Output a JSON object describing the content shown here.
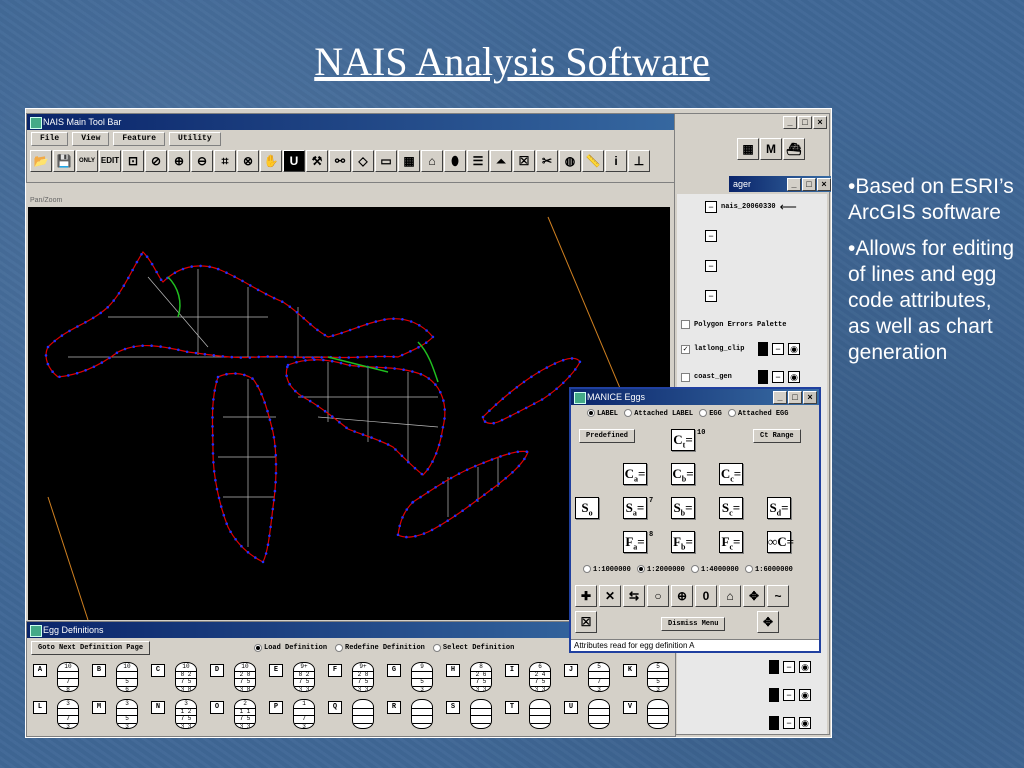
{
  "slide": {
    "title": "NAIS Analysis Software",
    "bullets": [
      "•Based on ESRI’s ArcGIS software",
      "•Allows for editing of lines and egg code attributes, as well as chart generation"
    ]
  },
  "main_toolbar": {
    "title": "NAIS Main Tool Bar",
    "menus": [
      "File",
      "View",
      "Feature",
      "Utility"
    ],
    "tools": [
      "open-folder",
      "save",
      "only",
      "edit",
      "select",
      "erase",
      "zoom-in",
      "zoom-out",
      "crop",
      "target",
      "pan-hand",
      "magnet",
      "hammer",
      "binoculars",
      "diamond",
      "rectangle",
      "grid",
      "polygon",
      "egg",
      "lines",
      "profile",
      "box-x",
      "scissors",
      "palette",
      "ruler",
      "info",
      "pin"
    ],
    "edit_label": "EDIT",
    "only_label": "ONLY"
  },
  "map_view": {
    "label": "Pan/Zoom"
  },
  "layer_manager": {
    "title": "ager",
    "extra_tools": [
      "checkered",
      "M",
      "ship"
    ],
    "layers": [
      {
        "name": "nais_20060330",
        "checked": false
      },
      {
        "name": "",
        "checked": false
      },
      {
        "name": "",
        "checked": false
      },
      {
        "name": "",
        "checked": false
      },
      {
        "name": "Polygon Errors Palette",
        "checked": false
      },
      {
        "name": "latlong_clip",
        "checked": true
      },
      {
        "name": "coast_gen",
        "checked": false
      }
    ]
  },
  "manice_eggs": {
    "title": "MANICE Eggs",
    "radio_options": [
      "LABEL",
      "Attached LABEL",
      "EGG",
      "Attached EGG"
    ],
    "selected_radio": "LABEL",
    "predefined_label": "Predefined",
    "ct_range_label": "Ct Range",
    "ct_value": "10",
    "sa_value": "7",
    "fa_value": "8",
    "scales": [
      "1:1000000",
      "1:2000000",
      "1:4000000",
      "1:6000000"
    ],
    "selected_scale": "1:2000000",
    "dismiss_label": "Dismiss Menu",
    "status": "Attributes read for egg definition A"
  },
  "egg_definitions": {
    "title": "Egg Definitions",
    "goto_label": "Goto Next Definition Page",
    "modes": [
      "Load Definition",
      "Redefine Definition",
      "Select Definition"
    ],
    "selected_mode": "Load Definition",
    "row1": [
      {
        "label": "A",
        "vals": [
          "10",
          "",
          "7",
          "8"
        ]
      },
      {
        "label": "B",
        "vals": [
          "10",
          "",
          "5",
          "6"
        ]
      },
      {
        "label": "C",
        "vals": [
          "10",
          "8 2",
          "7 5",
          "3 8"
        ]
      },
      {
        "label": "D",
        "vals": [
          "10",
          "2 8",
          "7 5",
          "3 8"
        ]
      },
      {
        "label": "E",
        "vals": [
          "9+",
          "8 2",
          "7 5",
          "3 3"
        ]
      },
      {
        "label": "F",
        "vals": [
          "9+",
          "2 8",
          "7 5",
          "3 3"
        ]
      },
      {
        "label": "G",
        "vals": [
          "9",
          "",
          "5",
          "3"
        ]
      },
      {
        "label": "H",
        "vals": [
          "8",
          "2 6",
          "7 5",
          "3 3"
        ]
      },
      {
        "label": "I",
        "vals": [
          "6",
          "2 4",
          "7 5",
          "3 3"
        ]
      },
      {
        "label": "J",
        "vals": [
          "5",
          "",
          "7",
          "3"
        ]
      },
      {
        "label": "K",
        "vals": [
          "5",
          "",
          "5",
          "3"
        ]
      }
    ],
    "row2": [
      {
        "label": "L",
        "vals": [
          "3",
          "",
          "7",
          "3"
        ]
      },
      {
        "label": "M",
        "vals": [
          "3",
          "",
          "5",
          "3"
        ]
      },
      {
        "label": "N",
        "vals": [
          "3",
          "1 2",
          "7 5",
          "3 3"
        ]
      },
      {
        "label": "O",
        "vals": [
          "2",
          "1 1",
          "7 5",
          "3 3"
        ]
      },
      {
        "label": "P",
        "vals": [
          "1",
          "",
          "7",
          "3"
        ]
      },
      {
        "label": "Q",
        "vals": [
          "",
          "",
          "",
          ""
        ]
      },
      {
        "label": "R",
        "vals": [
          "",
          "",
          "",
          ""
        ]
      },
      {
        "label": "S",
        "vals": [
          "",
          "",
          "",
          ""
        ]
      },
      {
        "label": "T",
        "vals": [
          "",
          "",
          "",
          ""
        ]
      },
      {
        "label": "U",
        "vals": [
          "",
          "",
          "",
          ""
        ]
      },
      {
        "label": "V",
        "vals": [
          "",
          "",
          "",
          ""
        ]
      }
    ]
  },
  "colors": {
    "slide_bg": "#3f6796",
    "titlebar": "#0a246a",
    "coast": "#e00000",
    "grid": "#bbbbbb",
    "blue_pts": "#2030ff",
    "green_lines": "#20c020"
  }
}
